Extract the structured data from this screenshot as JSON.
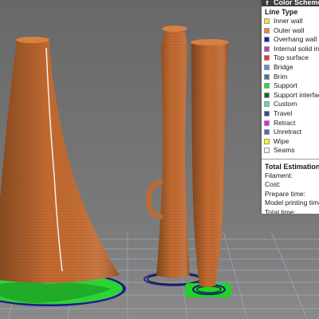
{
  "legend": {
    "header_title": "Color Scheme",
    "line_type_title": "Line Type",
    "items": [
      {
        "label": "Inner wall",
        "color": "#ffe23a"
      },
      {
        "label": "Outer wall",
        "color": "#ff7d38"
      },
      {
        "label": "Overhang wall",
        "color": "#1a1acc"
      },
      {
        "label": "Internal solid infill",
        "color": "#b23bd6"
      },
      {
        "label": "Top surface",
        "color": "#ff2e38"
      },
      {
        "label": "Bridge",
        "color": "#6d8bd0"
      },
      {
        "label": "Brim",
        "color": "#3c7a8c"
      },
      {
        "label": "Support",
        "color": "#22e22a"
      },
      {
        "label": "Support interface",
        "color": "#0d6e16"
      },
      {
        "label": "Custom",
        "color": "#63d9a6"
      },
      {
        "label": "Travel",
        "color": "#3344a0"
      },
      {
        "label": "Retract",
        "color": "#d92bd9"
      },
      {
        "label": "Unretract",
        "color": "#5a5ae0"
      },
      {
        "label": "Wipe",
        "color": "#ffff00"
      },
      {
        "label": "Seams",
        "color": "#f2f2f2"
      }
    ]
  },
  "estimation": {
    "title": "Total Estimation",
    "rows": [
      {
        "label": "Filament:"
      },
      {
        "label": "Cost:"
      },
      {
        "label": "Prepare time:"
      },
      {
        "label": "Model printing time:"
      },
      {
        "label": "Total time:"
      }
    ]
  }
}
